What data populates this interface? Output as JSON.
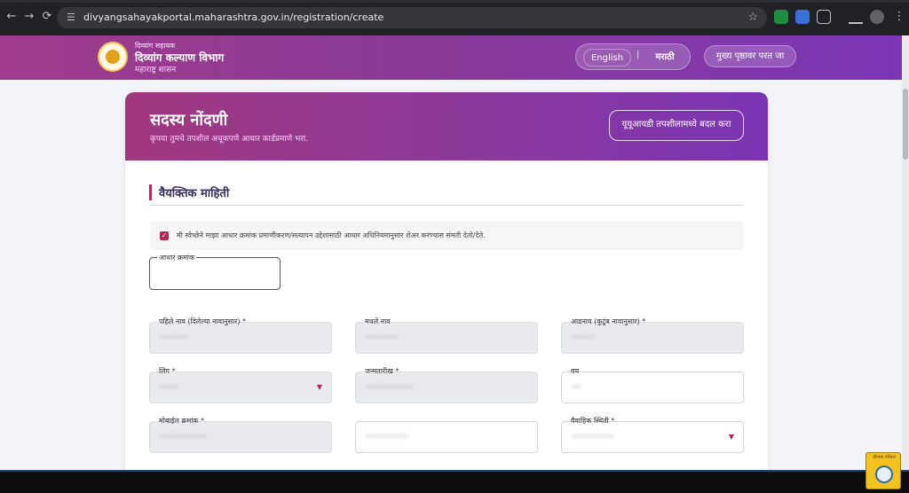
{
  "browser": {
    "url": "divyangsahayakportal.maharashtra.gov.in/registration/create",
    "back_glyph": "←",
    "forward_glyph": "→",
    "reload_glyph": "⟳",
    "site_info_glyph": "☰",
    "star_glyph": "☆",
    "menu_glyph": "⋮",
    "icons": [
      "back-arrow-icon",
      "forward-arrow-icon",
      "reload-icon",
      "site-settings-icon",
      "bookmark-star-icon",
      "extension-icon",
      "download-icon",
      "menu-icon"
    ]
  },
  "header": {
    "brand_top": "दिव्यांग सहायक",
    "brand_main": "दिव्यांग कल्याण विभाग",
    "brand_sub": "महाराष्ट्र शासन",
    "lang_english": "English",
    "lang_separator": "|",
    "lang_marathi": "मराठी",
    "home_button": "मुख्य पृष्ठावर परत जा"
  },
  "card": {
    "title": "सदस्य नोंदणी",
    "subtitle": "कृपया तुमचे तपशील अचूकपणे आधार कार्डप्रमाणे भरा.",
    "udid_button": "यूयूआयडी तपशीलामध्ये बदल करा",
    "section_title": "वैयक्तिक माहिती",
    "consent_check": "✓",
    "consent_text": "मी स्वेच्छेने माझा आधार क्रमांक प्रमाणीकरण/सत्यापन उद्देशासाठी आधार अधिनियमानुसार शेअर करण्यास संमती देतो/देते.",
    "aadhaar_label": "आधार क्रमांक"
  },
  "fields": {
    "first_name": {
      "label": "पहिले नाव (दिलेल्या नावानुसार) *",
      "value": "••••••"
    },
    "middle_name": {
      "label": "मधले नाव",
      "value": "•••••••"
    },
    "surname": {
      "label": "आडनाव (कुटुंब नावानुसार) *",
      "value": "•••••"
    },
    "gender": {
      "label": "लिंग *",
      "value": "••••",
      "arrow": "▼"
    },
    "dob": {
      "label": "जन्मतारीख *",
      "value": "••••••••••"
    },
    "age": {
      "label": "वय",
      "value": "••"
    },
    "mobile": {
      "label": "मोबाईल क्रमांक *",
      "value": "••••••••••"
    },
    "email": {
      "label": "",
      "value": "•••••••••"
    },
    "marital": {
      "label": "वैवाहिक स्थिती *",
      "value": "•••••••••",
      "arrow": "▼"
    }
  },
  "badge": {
    "text": "योजना परिवार"
  },
  "colors": {
    "brand_start": "#a03b8c",
    "brand_end": "#7b35b5",
    "accent": "#b02a52"
  }
}
